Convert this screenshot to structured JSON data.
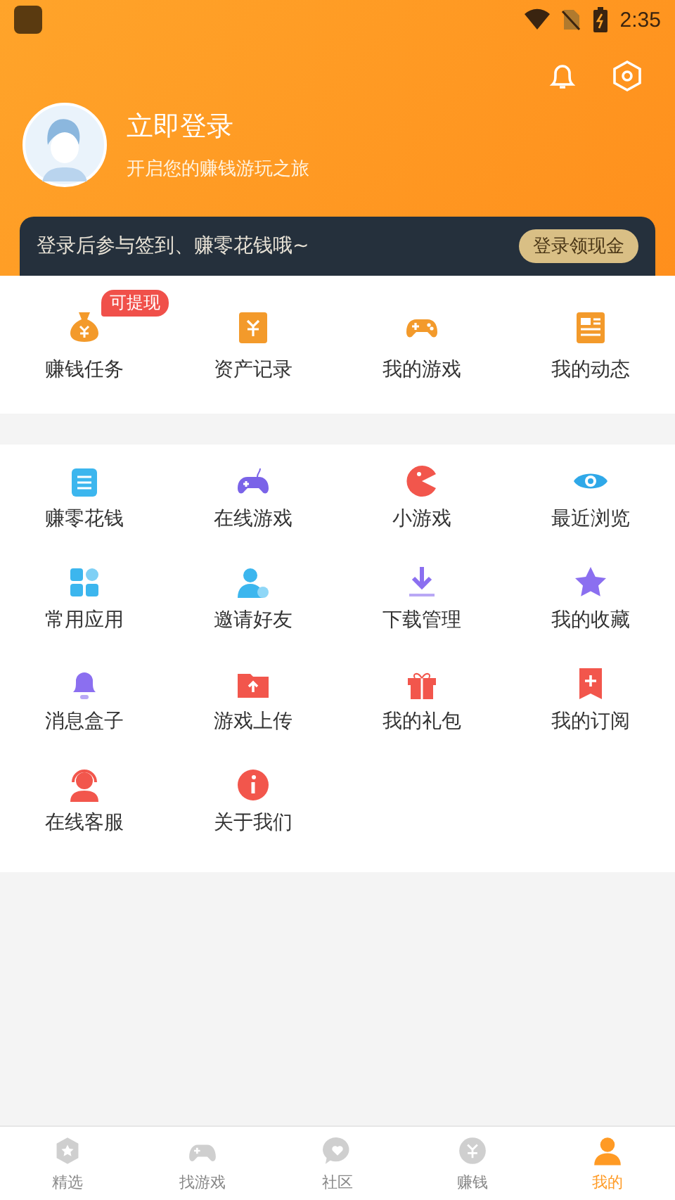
{
  "status_bar": {
    "time": "2:35"
  },
  "profile": {
    "title": "立即登录",
    "subtitle": "开启您的赚钱游玩之旅"
  },
  "banner": {
    "text": "登录后参与签到、赚零花钱哦~",
    "button": "登录领现金"
  },
  "quick_actions": [
    {
      "label": "赚钱任务",
      "badge": "可提现"
    },
    {
      "label": "资产记录"
    },
    {
      "label": "我的游戏"
    },
    {
      "label": "我的动态"
    }
  ],
  "menu": [
    {
      "label": "赚零花钱"
    },
    {
      "label": "在线游戏"
    },
    {
      "label": "小游戏"
    },
    {
      "label": "最近浏览"
    },
    {
      "label": "常用应用"
    },
    {
      "label": "邀请好友"
    },
    {
      "label": "下载管理"
    },
    {
      "label": "我的收藏"
    },
    {
      "label": "消息盒子"
    },
    {
      "label": "游戏上传"
    },
    {
      "label": "我的礼包"
    },
    {
      "label": "我的订阅"
    },
    {
      "label": "在线客服"
    },
    {
      "label": "关于我们"
    }
  ],
  "tab_bar": [
    {
      "label": "精选",
      "selected": false
    },
    {
      "label": "找游戏",
      "selected": false
    },
    {
      "label": "社区",
      "selected": false
    },
    {
      "label": "赚钱",
      "selected": false
    },
    {
      "label": "我的",
      "selected": true
    }
  ]
}
